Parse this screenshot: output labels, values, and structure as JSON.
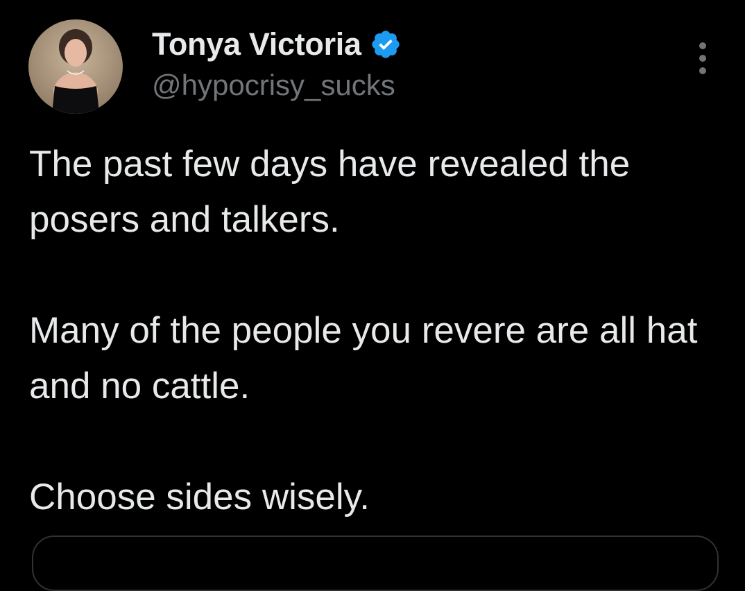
{
  "tweet": {
    "author": {
      "display_name": "Tonya Victoria",
      "handle": "@hypocrisy_sucks",
      "verified": true,
      "avatar_icon": "profile-photo",
      "verified_icon": "verified-badge-icon",
      "verified_color": "#1d9bf0"
    },
    "more_icon": "more-options-icon",
    "paragraphs": [
      "The past few days have revealed the posers and talkers.",
      "Many of the people you revere are all hat and no cattle.",
      "Choose sides wisely."
    ]
  },
  "colors": {
    "background": "#000000",
    "text_primary": "#e7e9ea",
    "text_secondary": "#71767b",
    "border": "#2f3336"
  }
}
